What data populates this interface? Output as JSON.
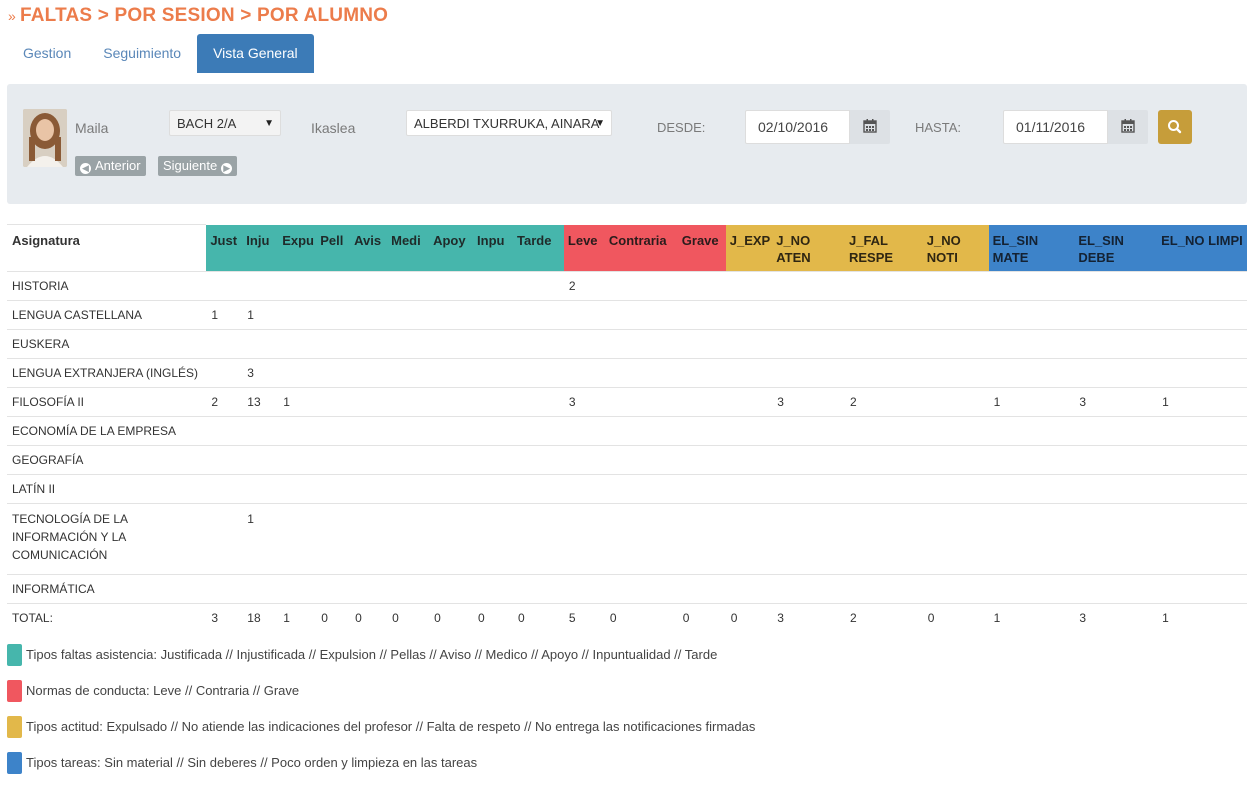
{
  "title": "FALTAS > POR SESION > POR ALUMNO",
  "title_arrow": "»",
  "tabs": [
    {
      "label": "Gestion",
      "active": false
    },
    {
      "label": "Seguimiento",
      "active": false
    },
    {
      "label": "Vista General",
      "active": true
    }
  ],
  "filters": {
    "user_name": "Maila",
    "prev_label": "Anterior",
    "next_label": "Siguiente",
    "group_value": "BACH 2/A",
    "student_label": "Ikaslea",
    "student_value": "ALBERDI TXURRUKA, AINARA",
    "from_label": "DESDE:",
    "from_value": "02/10/2016",
    "to_label": "HASTA:",
    "to_value": "01/11/2016"
  },
  "colors": {
    "teal": "#46b6ac",
    "red": "#f0575f",
    "yellow": "#e2b84a",
    "blue": "#3d83c9",
    "accent": "#ec7c4b",
    "search": "#c69d3a"
  },
  "table": {
    "subject_header": "Asignatura",
    "columns": [
      {
        "label": "Just",
        "group": "teal"
      },
      {
        "label": "Inju",
        "group": "teal"
      },
      {
        "label": "Expu",
        "group": "teal"
      },
      {
        "label": "Pell",
        "group": "teal"
      },
      {
        "label": "Avis",
        "group": "teal"
      },
      {
        "label": "Medi",
        "group": "teal"
      },
      {
        "label": "Apoy",
        "group": "teal"
      },
      {
        "label": "Inpu",
        "group": "teal"
      },
      {
        "label": "Tarde",
        "group": "teal"
      },
      {
        "label": "Leve",
        "group": "red"
      },
      {
        "label": "Contraria",
        "group": "red"
      },
      {
        "label": "Grave",
        "group": "red"
      },
      {
        "label": "J_EXP",
        "group": "yel"
      },
      {
        "label": "J_NO ATEN",
        "group": "yel"
      },
      {
        "label": "J_FAL RESPE",
        "group": "yel"
      },
      {
        "label": "J_NO NOTI",
        "group": "yel"
      },
      {
        "label": "EL_SIN MATE",
        "group": "blue"
      },
      {
        "label": "EL_SIN DEBE",
        "group": "blue"
      },
      {
        "label": "EL_NO LIMPI",
        "group": "blue"
      }
    ],
    "rows": [
      {
        "subject": "HISTORIA",
        "cells": [
          "",
          "",
          "",
          "",
          "",
          "",
          "",
          "",
          "",
          "2",
          "",
          "",
          "",
          "",
          "",
          "",
          "",
          "",
          ""
        ]
      },
      {
        "subject": "LENGUA CASTELLANA",
        "cells": [
          "1",
          "1",
          "",
          "",
          "",
          "",
          "",
          "",
          "",
          "",
          "",
          "",
          "",
          "",
          "",
          "",
          "",
          "",
          ""
        ]
      },
      {
        "subject": "EUSKERA",
        "cells": [
          "",
          "",
          "",
          "",
          "",
          "",
          "",
          "",
          "",
          "",
          "",
          "",
          "",
          "",
          "",
          "",
          "",
          "",
          ""
        ]
      },
      {
        "subject": "LENGUA EXTRANJERA (INGLÉS)",
        "cells": [
          "",
          "3",
          "",
          "",
          "",
          "",
          "",
          "",
          "",
          "",
          "",
          "",
          "",
          "",
          "",
          "",
          "",
          "",
          ""
        ]
      },
      {
        "subject": "FILOSOFÍA II",
        "cells": [
          "2",
          "13",
          "1",
          "",
          "",
          "",
          "",
          "",
          "",
          "3",
          "",
          "",
          "",
          "3",
          "2",
          "",
          "1",
          "3",
          "1"
        ]
      },
      {
        "subject": "ECONOMÍA DE LA EMPRESA",
        "cells": [
          "",
          "",
          "",
          "",
          "",
          "",
          "",
          "",
          "",
          "",
          "",
          "",
          "",
          "",
          "",
          "",
          "",
          "",
          ""
        ]
      },
      {
        "subject": "GEOGRAFÍA",
        "cells": [
          "",
          "",
          "",
          "",
          "",
          "",
          "",
          "",
          "",
          "",
          "",
          "",
          "",
          "",
          "",
          "",
          "",
          "",
          ""
        ]
      },
      {
        "subject": "LATÍN II",
        "cells": [
          "",
          "",
          "",
          "",
          "",
          "",
          "",
          "",
          "",
          "",
          "",
          "",
          "",
          "",
          "",
          "",
          "",
          "",
          ""
        ]
      },
      {
        "subject": "TECNOLOGÍA DE LA INFORMACIÓN Y LA COMUNICACIÓN",
        "cells": [
          "",
          "1",
          "",
          "",
          "",
          "",
          "",
          "",
          "",
          "",
          "",
          "",
          "",
          "",
          "",
          "",
          "",
          "",
          ""
        ],
        "tall": true
      },
      {
        "subject": "INFORMÁTICA",
        "cells": [
          "",
          "",
          "",
          "",
          "",
          "",
          "",
          "",
          "",
          "",
          "",
          "",
          "",
          "",
          "",
          "",
          "",
          "",
          ""
        ]
      }
    ],
    "total": {
      "subject": "TOTAL:",
      "cells": [
        "3",
        "18",
        "1",
        "0",
        "0",
        "0",
        "0",
        "0",
        "0",
        "5",
        "0",
        "0",
        "0",
        "3",
        "2",
        "0",
        "1",
        "3",
        "1"
      ]
    }
  },
  "legend": [
    {
      "group": "teal",
      "text": "Tipos faltas asistencia: Justificada // Injustificada // Expulsion // Pellas // Aviso // Medico // Apoyo // Inpuntualidad // Tarde"
    },
    {
      "group": "red",
      "text": "Normas de conducta: Leve // Contraria // Grave"
    },
    {
      "group": "yel",
      "text": "Tipos actitud: Expulsado // No atiende las indicaciones del profesor // Falta de respeto // No entrega las notificaciones firmadas"
    },
    {
      "group": "blue",
      "text": "Tipos tareas: Sin material // Sin deberes // Poco orden y limpieza en las tareas"
    }
  ]
}
